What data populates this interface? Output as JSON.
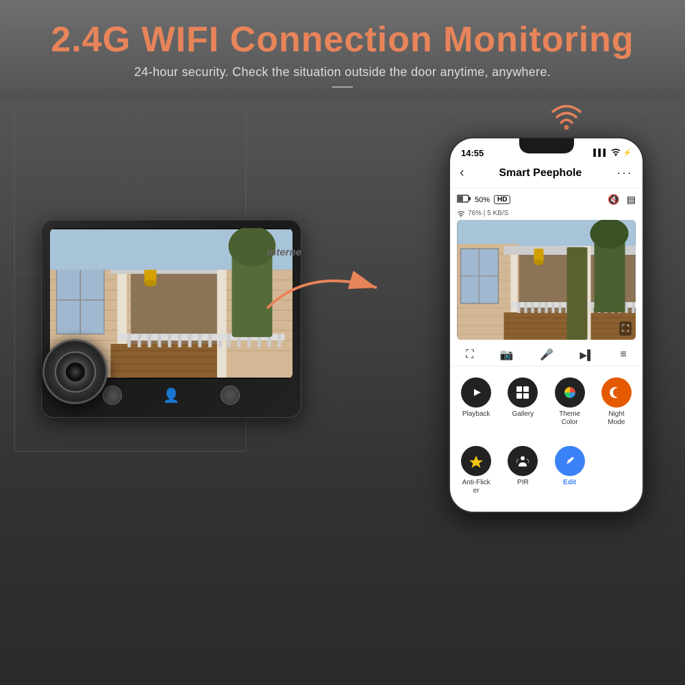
{
  "header": {
    "main_title": "2.4G WIFI Connection Monitoring",
    "subtitle": "24-hour security. Check the situation outside the door anytime, anywhere."
  },
  "arrow_label": "interne",
  "phone": {
    "status_bar": {
      "time": "14:55",
      "signal": "▌▌▌",
      "wifi": "WiFi",
      "battery": "⚡"
    },
    "app_title": "Smart Peephole",
    "back_icon": "‹",
    "menu_icon": "···",
    "battery_percent": "50%",
    "hd_badge": "HD",
    "mute_icon": "🔇",
    "menu_icon2": "▤",
    "wifi_signal": "76% | 5 KB/S",
    "controls": [
      {
        "icon": "⛶",
        "label": ""
      },
      {
        "icon": "📷",
        "label": ""
      },
      {
        "icon": "🎤",
        "label": ""
      },
      {
        "icon": "▶",
        "label": ""
      },
      {
        "icon": "≡",
        "label": ""
      }
    ],
    "features": [
      {
        "label": "Playback",
        "icon": "▶",
        "bg": "dark"
      },
      {
        "label": "Gallery",
        "icon": "🖼",
        "bg": "dark"
      },
      {
        "label": "Theme\nColor",
        "icon": "🎨",
        "bg": "dark"
      },
      {
        "label": "Night\nMode",
        "icon": "☾",
        "bg": "orange"
      }
    ],
    "features2": [
      {
        "label": "Anti-Flick\ner",
        "icon": "⚡",
        "bg": "dark"
      },
      {
        "label": "PIR",
        "icon": "👤",
        "bg": "dark"
      },
      {
        "label": "Edit",
        "icon": "✏",
        "bg": "blue"
      }
    ]
  }
}
